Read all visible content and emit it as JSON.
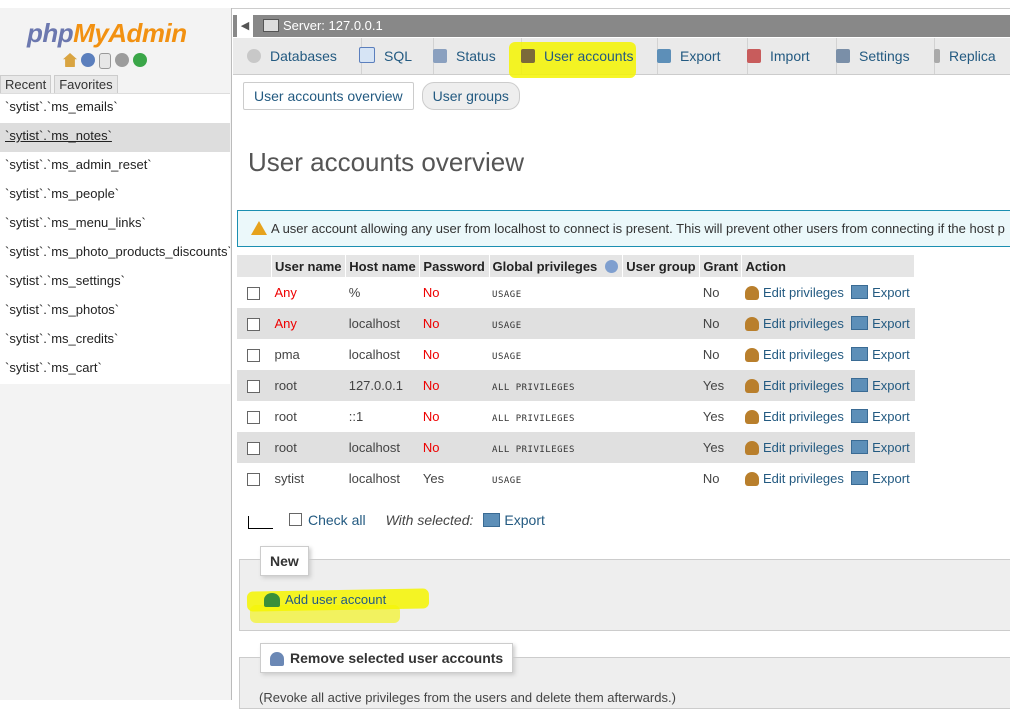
{
  "sidebar": {
    "logo_php": "php",
    "logo_my": "MyAdmin",
    "tabs": [
      "Recent",
      "Favorites"
    ],
    "items": [
      "`sytist`.`ms_emails`",
      "`sytist`.`ms_notes`",
      "`sytist`.`ms_admin_reset`",
      "`sytist`.`ms_people`",
      "`sytist`.`ms_menu_links`",
      "`sytist`.`ms_photo_products_discounts`",
      "`sytist`.`ms_settings`",
      "`sytist`.`ms_photos`",
      "`sytist`.`ms_credits`",
      "`sytist`.`ms_cart`"
    ]
  },
  "server": {
    "label": "Server: 127.0.0.1"
  },
  "tabs": {
    "databases": "Databases",
    "sql": "SQL",
    "status": "Status",
    "user_accounts": "User accounts",
    "export": "Export",
    "import": "Import",
    "settings": "Settings",
    "replication": "Replica"
  },
  "subtabs": {
    "overview": "User accounts overview",
    "groups": "User groups"
  },
  "page_title": "User accounts overview",
  "notice": "A user account allowing any user from localhost to connect is present. This will prevent other users from connecting if the host p",
  "table": {
    "headers": [
      "User name",
      "Host name",
      "Password",
      "Global privileges",
      "User group",
      "Grant",
      "Action"
    ],
    "rows": [
      {
        "user": "Any",
        "host": "%",
        "password": "No",
        "privs": "USAGE",
        "grant": "No"
      },
      {
        "user": "Any",
        "host": "localhost",
        "password": "No",
        "privs": "USAGE",
        "grant": "No"
      },
      {
        "user": "pma",
        "host": "localhost",
        "password": "No",
        "privs": "USAGE",
        "grant": "No"
      },
      {
        "user": "root",
        "host": "127.0.0.1",
        "password": "No",
        "privs": "ALL PRIVILEGES",
        "grant": "Yes"
      },
      {
        "user": "root",
        "host": "::1",
        "password": "No",
        "privs": "ALL PRIVILEGES",
        "grant": "Yes"
      },
      {
        "user": "root",
        "host": "localhost",
        "password": "No",
        "privs": "ALL PRIVILEGES",
        "grant": "Yes"
      },
      {
        "user": "sytist",
        "host": "localhost",
        "password": "Yes",
        "privs": "USAGE",
        "grant": "No"
      }
    ],
    "edit_label": "Edit privileges",
    "export_label": "Export"
  },
  "bulk": {
    "check_all": "Check all",
    "with_selected": "With selected:",
    "export": "Export"
  },
  "new_section": {
    "legend": "New",
    "add_user": "Add user account"
  },
  "remove_section": {
    "legend": "Remove selected user accounts",
    "revoke": "(Revoke all active privileges from the users and delete them afterwards.)"
  },
  "colors": {
    "accent": "#235a81",
    "highlight": "#f5f500",
    "warning": "#e00000"
  }
}
